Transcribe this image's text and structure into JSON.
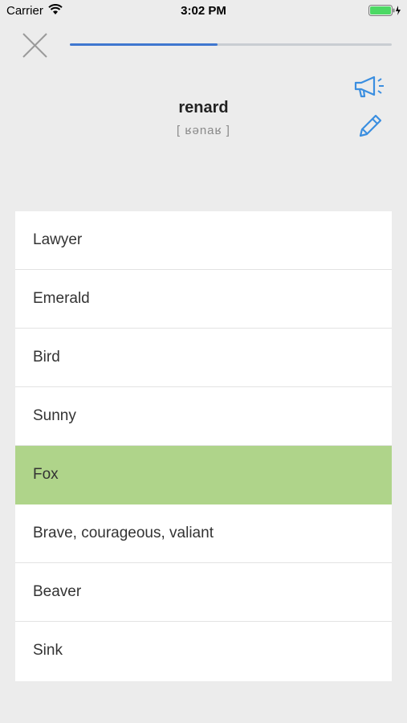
{
  "status_bar": {
    "carrier": "Carrier",
    "time": "3:02 PM",
    "battery_color": "#4cd964"
  },
  "progress": {
    "fraction": 0.46,
    "color": "#3f77cf"
  },
  "icons": {
    "close": "close-icon",
    "audio": "megaphone-icon",
    "edit": "pencil-icon",
    "accent_color": "#3a8ee0"
  },
  "question": {
    "word": "renard",
    "phonetic": "[ ʁənaʁ ]"
  },
  "answers": [
    {
      "label": "Lawyer",
      "state": "default"
    },
    {
      "label": "Emerald",
      "state": "default"
    },
    {
      "label": "Bird",
      "state": "default"
    },
    {
      "label": "Sunny",
      "state": "default"
    },
    {
      "label": "Fox",
      "state": "correct"
    },
    {
      "label": "Brave, courageous, valiant",
      "state": "default"
    },
    {
      "label": "Beaver",
      "state": "default"
    },
    {
      "label": "Sink",
      "state": "default"
    }
  ],
  "colors": {
    "correct": "#afd48a",
    "background": "#ececec"
  }
}
